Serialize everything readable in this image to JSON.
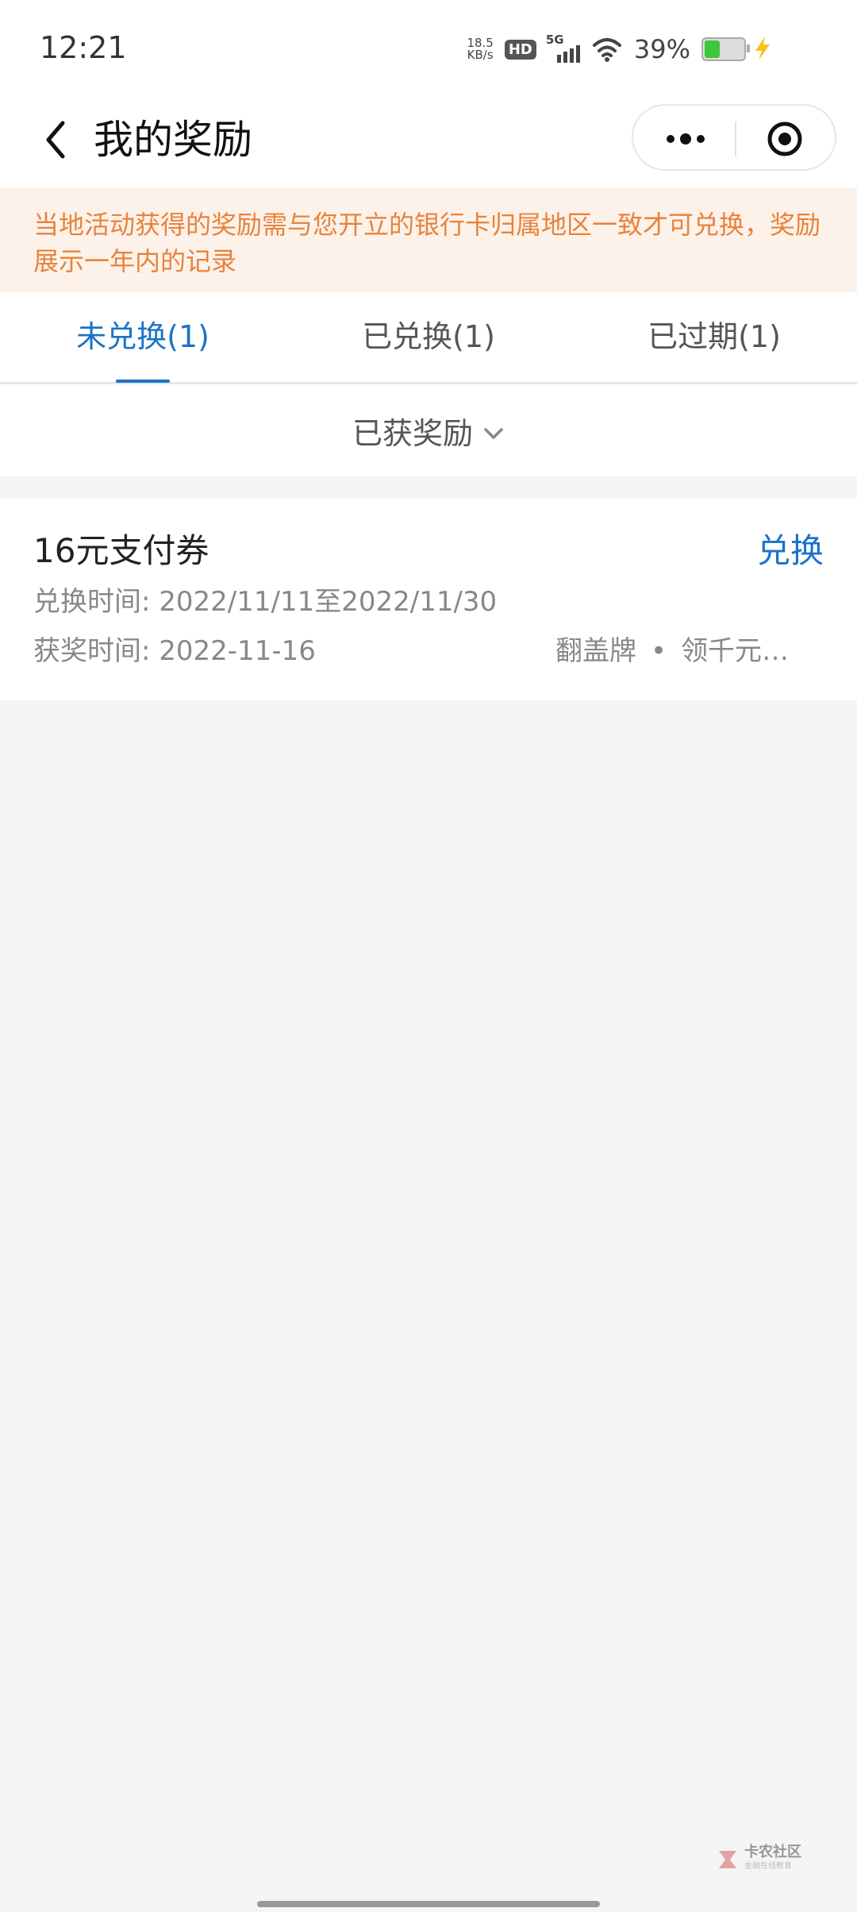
{
  "status_bar": {
    "time": "12:21",
    "net_speed_value": "18.5",
    "net_speed_unit": "KB/s",
    "hd_label": "HD",
    "network_label": "5G",
    "battery_percent": "39%",
    "battery_level": 0.39,
    "battery_color": "#3cc73c"
  },
  "nav": {
    "title": "我的奖励",
    "back_icon": "chevron-left-icon",
    "more_icon": "more-dots-icon",
    "close_icon": "target-close-icon"
  },
  "notice": {
    "text": "当地活动获得的奖励需与您开立的银行卡归属地区一致才可兑换，奖励展示一年内的记录",
    "color": "#e8833a",
    "background": "#fdf2ea"
  },
  "tabs": [
    {
      "label": "未兑换(1)",
      "active": true
    },
    {
      "label": "已兑换(1)",
      "active": false
    },
    {
      "label": "已过期(1)",
      "active": false
    }
  ],
  "accent_color": "#1a73c9",
  "filter": {
    "label": "已获奖励",
    "icon": "chevron-down-icon"
  },
  "rewards": [
    {
      "title": "16元支付券",
      "action": "兑换",
      "redeem_time": "兑换时间: 2022/11/11至2022/11/30",
      "award_time": "获奖时间: 2022-11-16",
      "source_type": "翻盖牌",
      "source_separator": "•",
      "source_name": "领千元…"
    }
  ],
  "watermark": {
    "main": "卡农社区",
    "sub": "金融在线教育"
  }
}
